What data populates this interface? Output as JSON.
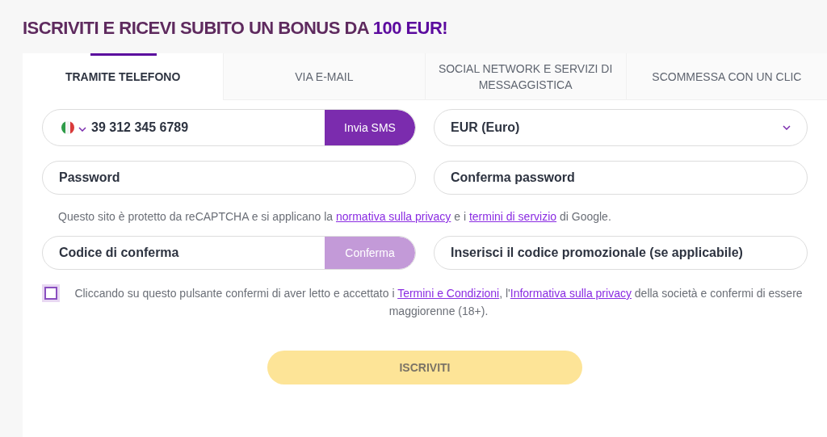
{
  "headline": {
    "text": "ISCRIVITI E RICEVI SUBITO UN BONUS DA",
    "highlight": "100 EUR!"
  },
  "tabs": [
    {
      "label": "TRAMITE TELEFONO",
      "selected": true
    },
    {
      "label": "VIA E-MAIL",
      "selected": false
    },
    {
      "label": "SOCIAL NETWORK E SERVIZI DI MESSAGGISTICA",
      "selected": false
    },
    {
      "label": "SCOMMESSA CON UN CLIC",
      "selected": false
    }
  ],
  "phone": {
    "value": "39 312 345 6789",
    "button": {
      "label": "Invia SMS",
      "disabled": false
    }
  },
  "currency": {
    "value": "EUR (Euro)"
  },
  "password": {
    "placeholder": "Password"
  },
  "confirm_password": {
    "placeholder": "Conferma password"
  },
  "recaptcha_notice": [
    {
      "kind": "text",
      "text": "Questo sito è protetto da reCAPTCHA e si applicano la "
    },
    {
      "kind": "link",
      "text": "normativa sulla privacy"
    },
    {
      "kind": "text",
      "text": " e i "
    },
    {
      "kind": "link",
      "text": "termini di servizio"
    },
    {
      "kind": "text",
      "text": " di Google."
    }
  ],
  "confirmation_code": {
    "placeholder": "Codice di conferma",
    "button": {
      "label": "Conferma",
      "disabled": true
    }
  },
  "promo_code": {
    "placeholder": "Inserisci il codice promozionale (se applicabile)"
  },
  "consent": {
    "checked": false,
    "parts": [
      {
        "kind": "text",
        "text": "Cliccando su questo pulsante confermi di aver letto e accettato i "
      },
      {
        "kind": "link",
        "text": "Termini e Condizioni"
      },
      {
        "kind": "text",
        "text": ", l'"
      },
      {
        "kind": "link",
        "text": "Informativa sulla privacy"
      },
      {
        "kind": "text",
        "text": " della società e confermi di essere maggiorenne (18+)."
      }
    ]
  },
  "submit": {
    "label": "ISCRIVITI",
    "disabled": true
  }
}
